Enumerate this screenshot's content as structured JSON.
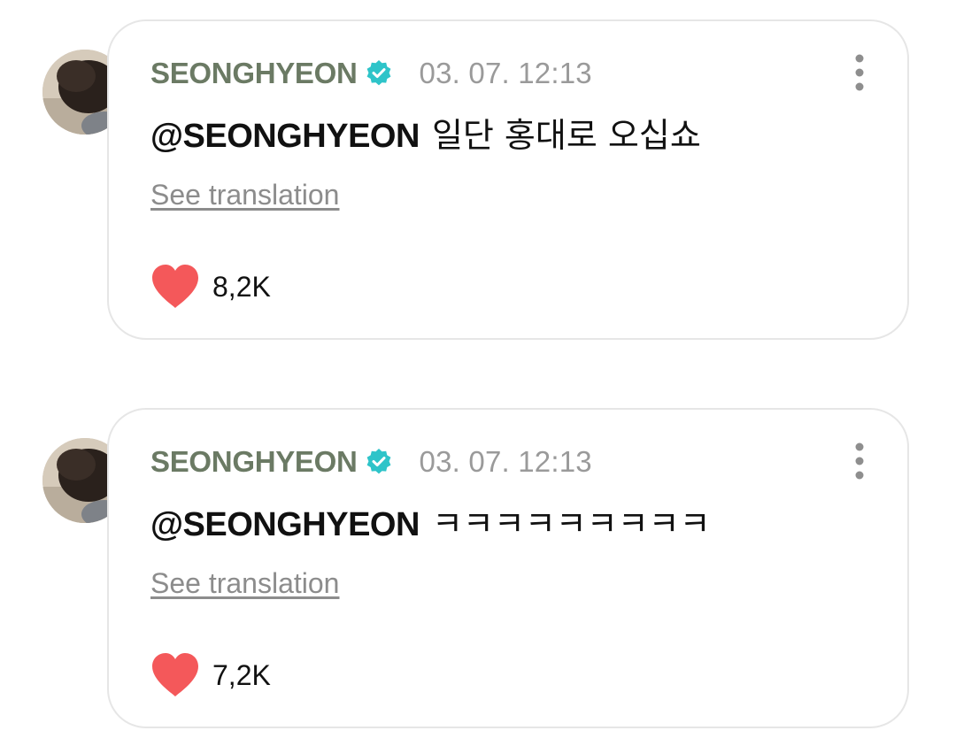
{
  "posts": [
    {
      "username": "SEONGHYEON",
      "timestamp": "03. 07. 12:13",
      "mention": "@SEONGHYEON",
      "text": "일단 홍대로 오십쇼",
      "translate_label": "See translation",
      "likes": "8,2K"
    },
    {
      "username": "SEONGHYEON",
      "timestamp": "03. 07. 12:13",
      "mention": "@SEONGHYEON",
      "text": "ㅋㅋㅋㅋㅋㅋㅋㅋㅋ",
      "translate_label": "See translation",
      "likes": "7,2K"
    }
  ],
  "icons": {
    "verified": "verified-badge-icon",
    "more": "more-vertical-icon",
    "like": "heart-icon"
  },
  "colors": {
    "username": "#6b7a64",
    "verified": "#2ec4c9",
    "heart": "#f4585a",
    "timestamp": "#9a9a9a",
    "translate": "#8c8c8c"
  }
}
